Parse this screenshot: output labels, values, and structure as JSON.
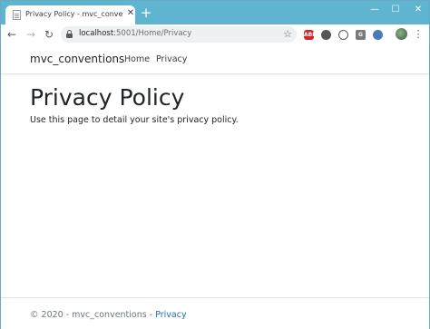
{
  "browser": {
    "tab": {
      "title": "Privacy Policy - mvc_conventions",
      "close": "✕"
    },
    "new_tab": "+",
    "window_controls": {
      "minimize": "—",
      "maximize": "☐",
      "close": "✕"
    },
    "nav": {
      "back": "←",
      "forward": "→",
      "reload": "↻"
    },
    "address": {
      "host": "localhost",
      "rest": ":5001/Home/Privacy"
    },
    "star": "☆",
    "extensions": {
      "abp": "ABP",
      "g": "G"
    },
    "menu": "⋮"
  },
  "site": {
    "brand": "mvc_conventions",
    "nav": [
      "Home",
      "Privacy"
    ]
  },
  "main": {
    "title": "Privacy Policy",
    "text": "Use this page to detail your site's privacy policy."
  },
  "footer": {
    "prefix": "© 2020 - mvc_conventions - ",
    "link": "Privacy"
  },
  "colors": {
    "tabstrip": "#5fb4cf",
    "link": "#1b6ec2",
    "text": "#212529"
  }
}
